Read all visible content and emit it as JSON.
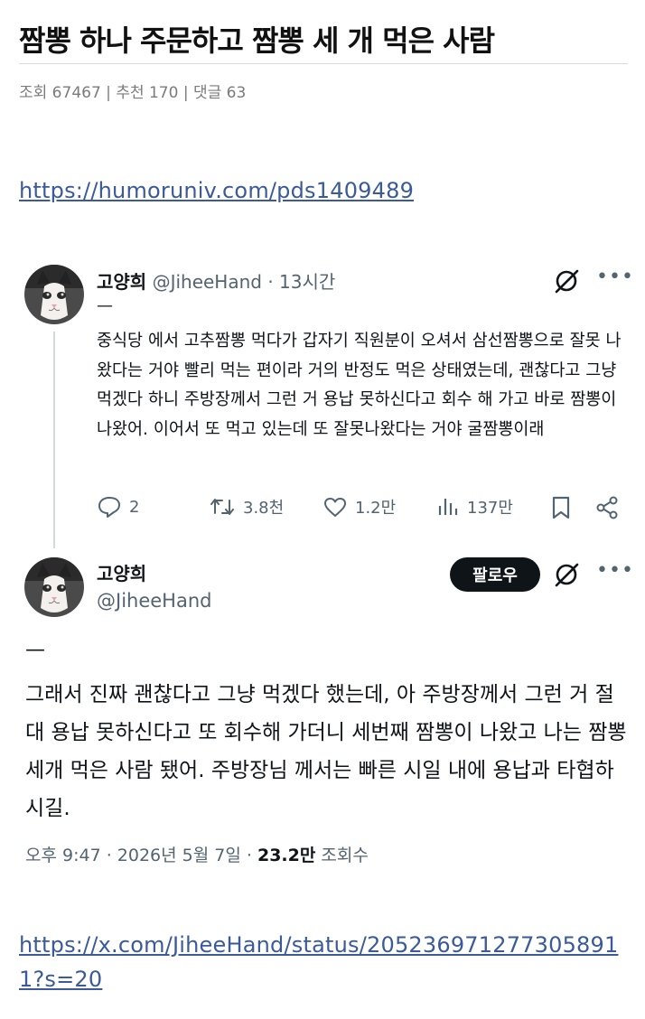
{
  "post": {
    "title": "짬뽕 하나 주문하고 짬뽕 세 개 먹은 사람",
    "views_label": "조회 67467",
    "recommend_label": "추천 170",
    "comments_label": "댓글 63",
    "separator": "|",
    "source_link": "https://humoruniv.com/pds1409489",
    "tweet_link": "https://x.com/JiheeHand/status/2052369712773058911?s=20"
  },
  "tweet1": {
    "name": "고양희",
    "handle": "@JiheeHand",
    "dot": "·",
    "time": "13시간",
    "dash": "—",
    "body": "중식당 에서 고추짬뽕 먹다가 갑자기 직원분이 오셔서 삼선짬뽕으로 잘못 나왔다는 거야 빨리 먹는 편이라 거의 반정도 먹은 상태였는데, 괜찮다고 그냥 먹겠다 하니 주방장께서 그런 거 용납 못하신다고 회수 해 가고 바로 짬뽕이 나왔어. 이어서 또 먹고 있는데 또 잘못나왔다는 거야 굴짬뽕이래",
    "more_icon": "more-dots",
    "actions": {
      "replies": "2",
      "reposts": "3.8천",
      "likes": "1.2만",
      "views": "137만"
    }
  },
  "tweet2": {
    "name": "고양희",
    "handle": "@JiheeHand",
    "follow_label": "팔로우",
    "dash": "—",
    "body": "그래서 진짜 괜찮다고 그냥 먹겠다 했는데, 아 주방장께서 그런 거 절대 용납 못하신다고 또 회수해 가더니 세번째 짬뽕이 나왔고 나는 짬뽕 세개 먹은 사람 됐어. 주방장님 께서는 빠른 시일 내에 용납과 타협하시길.",
    "time": "오후 9:47 · 2026년 5월 7일 ·",
    "views_count": "23.2만",
    "views_suffix": "조회수"
  },
  "colors": {
    "text": "#0f1419",
    "secondary": "#536471",
    "link": "#3a5a9b",
    "meta": "#7b7b7b",
    "follow_bg": "#0f1419"
  }
}
